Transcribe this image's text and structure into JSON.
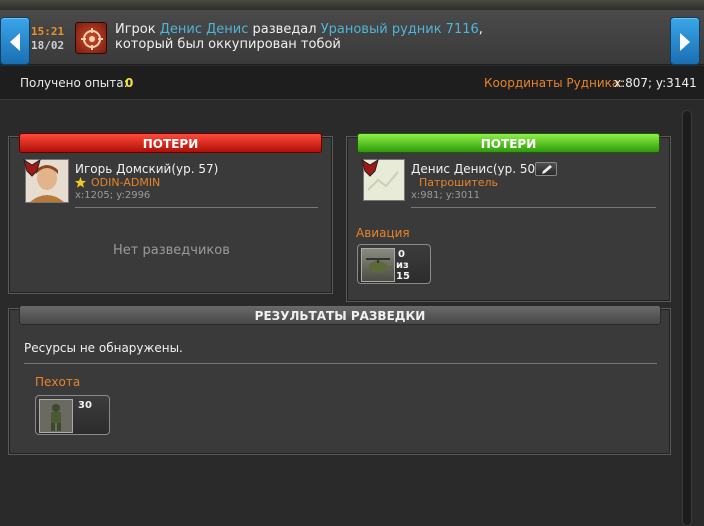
{
  "header": {
    "time": "15:21",
    "date": "18/02",
    "message_prefix": "Игрок ",
    "player_link": "Денис Денис",
    "message_mid": " разведал ",
    "mine_link": "Урановый рудник 7116",
    "message_suffix": ", который был оккупирован тобой"
  },
  "info": {
    "exp_label": "Получено опыта:",
    "exp_value": "0",
    "coord_label": "Координаты Рудника:",
    "coord_value": "x:807; y:3141"
  },
  "left_panel": {
    "title": "ПОТЕРИ",
    "player_name": "Игорь Домский(ур. 57)",
    "player_clan": "ODIN-ADMIN",
    "player_coords": "x:1205; y:2996",
    "no_scouts": "Нет разведчиков"
  },
  "right_panel": {
    "title": "ПОТЕРИ",
    "player_name": "Денис Денис(ур. 50)",
    "player_clan": "Патрошитель",
    "player_coords": "x:981; y:3011",
    "section": "Авиация",
    "unit": {
      "lost": "0",
      "of": "из",
      "total": "15"
    }
  },
  "results": {
    "title": "РЕЗУЛЬТАТЫ РАЗВЕДКИ",
    "resources_text": "Ресурсы не обнаружены.",
    "section": "Пехота",
    "unit": {
      "count": "30"
    }
  },
  "colors": {
    "accent_orange": "#e8832a",
    "link_blue": "#4fb5d8",
    "loss_red": "#d42a1c",
    "loss_green": "#5ac82a"
  },
  "icons": [
    "arrow-left-icon",
    "arrow-right-icon",
    "crosshair-icon",
    "star-icon",
    "edit-icon",
    "alliance-badge-icon"
  ]
}
